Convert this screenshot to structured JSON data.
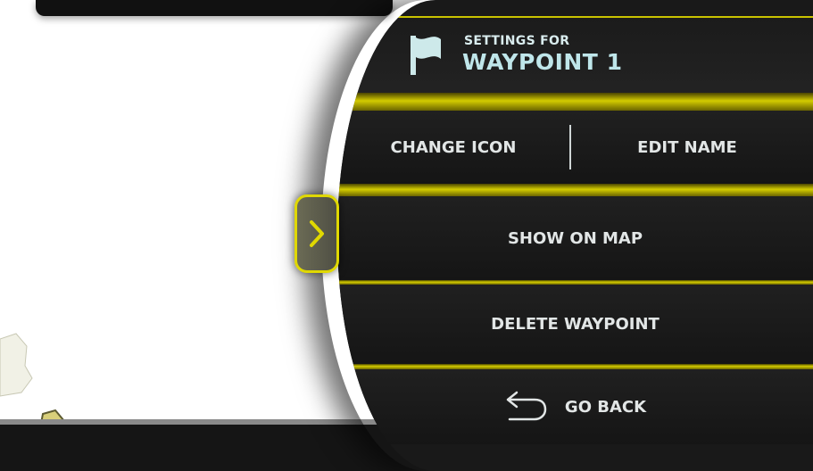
{
  "header": {
    "subtitle": "SETTINGS FOR",
    "title": "WAYPOINT 1",
    "icon": "flag-icon"
  },
  "menu": {
    "change_icon": "CHANGE ICON",
    "edit_name": "EDIT NAME",
    "show_on_map": "SHOW ON MAP",
    "delete_waypoint": "DELETE WAYPOINT",
    "go_back": "GO BACK",
    "go_back_icon": "return-arrow-icon"
  },
  "expand_tab": {
    "icon": "chevron-right-icon"
  },
  "colors": {
    "accent": "#d4cc00",
    "panel": "#191919",
    "header_text": "#bfe6ea",
    "menu_text": "#e2e6e6"
  }
}
